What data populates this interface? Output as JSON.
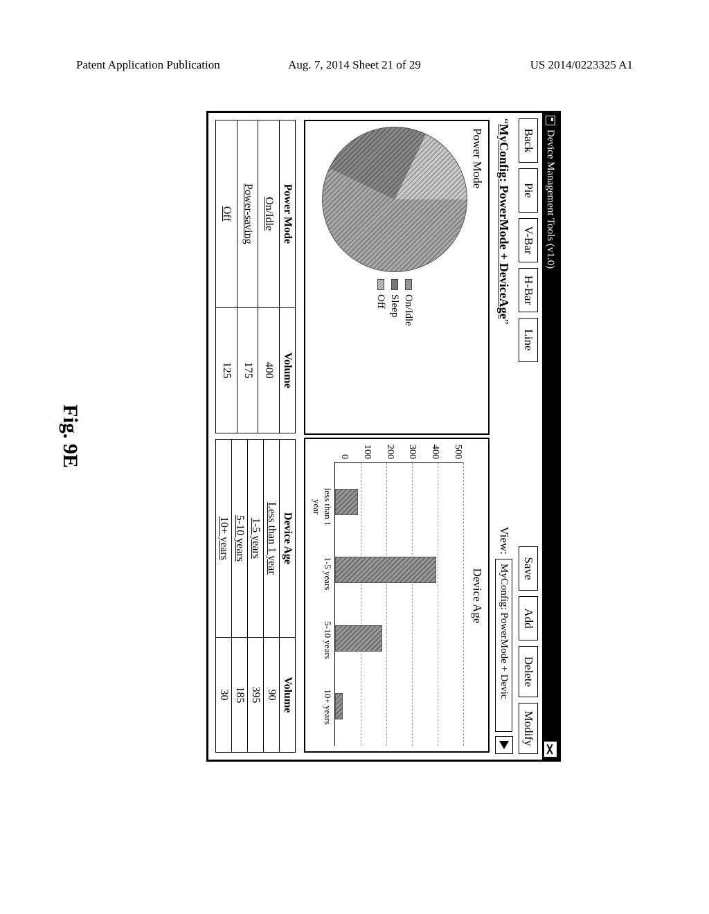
{
  "header": {
    "left": "Patent Application Publication",
    "mid": "Aug. 7, 2014  Sheet 21 of 29",
    "right": "US 2014/0223325 A1"
  },
  "window": {
    "title": "Device Management Tools (v1.0)"
  },
  "toolbar": {
    "back": "Back",
    "pie": "Pie",
    "vbar": "V-Bar",
    "hbar": "H-Bar",
    "line": "Line",
    "save": "Save",
    "add": "Add",
    "delete": "Delete",
    "modify": "Modify"
  },
  "config": {
    "quoted_prefix": "“",
    "quoted_suffix": "”",
    "name": "MyConfig: PowerMode + DeviceAge",
    "view_label": "View:",
    "view_value": "MyConfig: PowerMode + Devic"
  },
  "panels": {
    "left_title": "Power Mode",
    "right_title": "Device Age",
    "legend": [
      {
        "label": "On/Idle"
      },
      {
        "label": "Sleep"
      },
      {
        "label": "Off"
      }
    ],
    "yticks": [
      "500",
      "400",
      "300",
      "200",
      "100",
      "0"
    ]
  },
  "chart_data": [
    {
      "type": "pie",
      "title": "Power Mode",
      "series": [
        {
          "name": "On/Idle",
          "values": [
            400
          ]
        },
        {
          "name": "Sleep",
          "values": [
            175
          ]
        },
        {
          "name": "Off",
          "values": [
            125
          ]
        }
      ]
    },
    {
      "type": "bar",
      "title": "Device Age",
      "categories": [
        "less than 1 year",
        "1-5 years",
        "5-10 years",
        "10+ years"
      ],
      "values": [
        90,
        395,
        185,
        30
      ],
      "ylabel": "",
      "xlabel": "",
      "ylim": [
        0,
        500
      ]
    }
  ],
  "tables": {
    "left": {
      "headers": [
        "Power Mode",
        "Volume"
      ],
      "rows": [
        [
          "On/Idle",
          "400"
        ],
        [
          "Power-saving",
          "175"
        ],
        [
          "Off",
          "125"
        ]
      ]
    },
    "right": {
      "headers": [
        "Device Age",
        "Volume"
      ],
      "rows": [
        [
          "Less than 1 year",
          "90"
        ],
        [
          "1-5 years",
          "395"
        ],
        [
          "5-10 years",
          "185"
        ],
        [
          "10+ years",
          "30"
        ]
      ]
    }
  },
  "figure_label": "Fig. 9E"
}
